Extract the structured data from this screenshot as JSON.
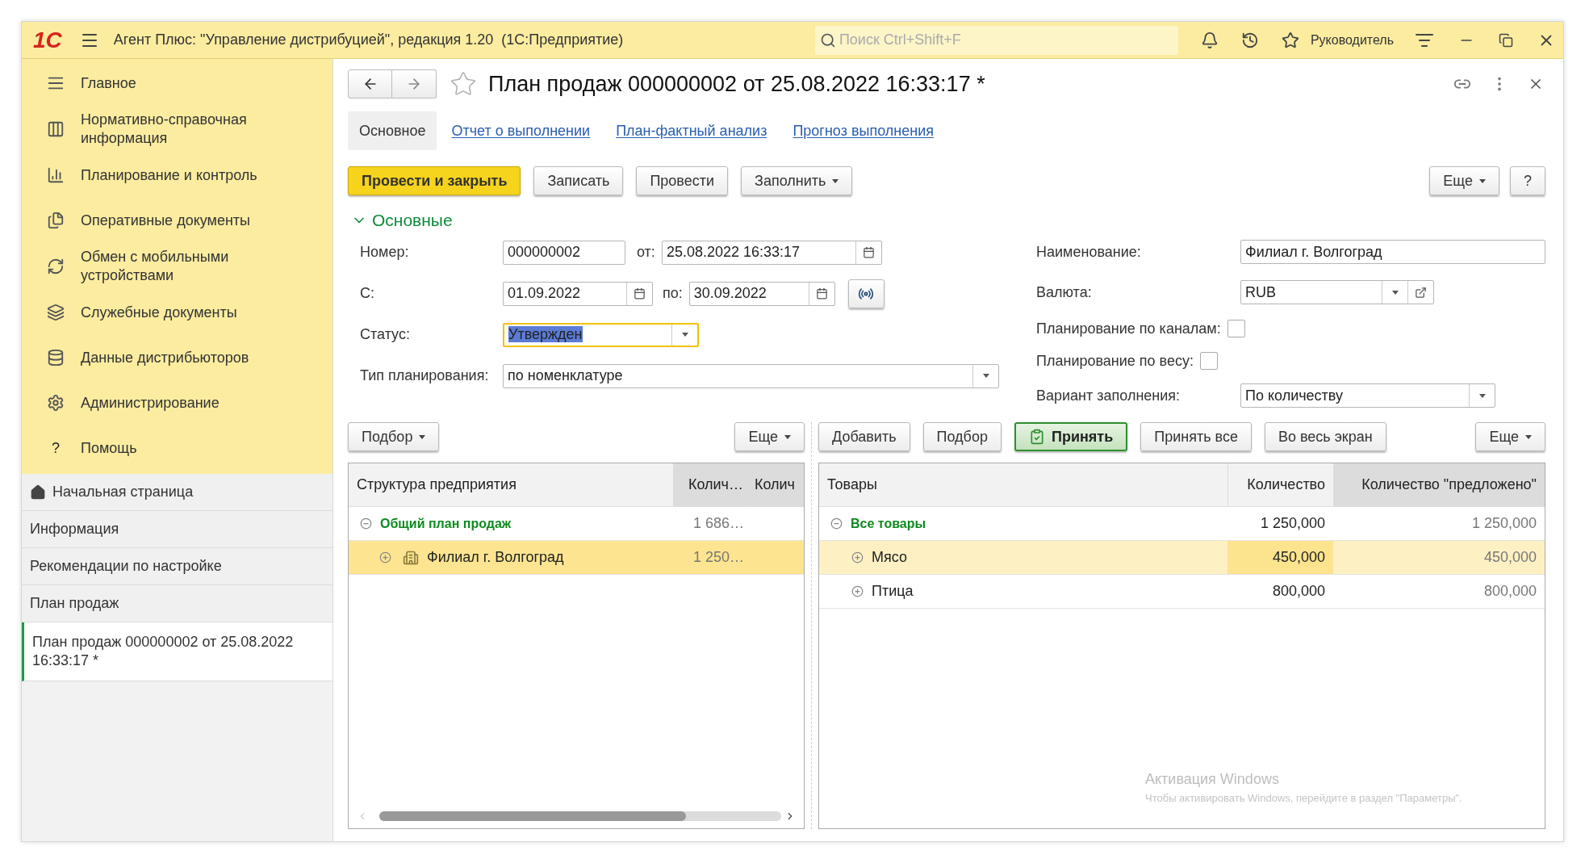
{
  "app_bar": {
    "logo": "1С",
    "title": "Агент Плюс: \"Управление дистрибуцией\", редакция 1.20  (1С:Предприятие)",
    "search": {
      "placeholder": "Поиск Ctrl+Shift+F"
    },
    "user": "Руководитель"
  },
  "sidebar": {
    "sections": [
      {
        "label": "Главное"
      },
      {
        "label": "Нормативно-справочная информация"
      },
      {
        "label": "Планирование и контроль"
      },
      {
        "label": "Оперативные документы"
      },
      {
        "label": "Обмен с мобильными устройствами"
      },
      {
        "label": "Служебные документы"
      },
      {
        "label": "Данные дистрибьюторов"
      },
      {
        "label": "Администрирование"
      },
      {
        "label": "Помощь",
        "kind": "help",
        "glyph": "?"
      }
    ],
    "pages": [
      {
        "label": "Начальная страница",
        "kind": "home",
        "selected": false
      },
      {
        "label": "Информация",
        "selected": false
      },
      {
        "label": "Рекомендации по настройке",
        "selected": false
      },
      {
        "label": "План продаж",
        "selected": false
      },
      {
        "label": "План продаж 000000002 от 25.08.2022 16:33:17 *",
        "selected": true
      }
    ]
  },
  "document": {
    "title": "План продаж 000000002 от 25.08.2022 16:33:17 *",
    "favorite": false,
    "tabs": [
      {
        "label": "Основное",
        "selected": true
      },
      {
        "label": "Отчет о выполнении",
        "selected": false
      },
      {
        "label": "План-фактный анализ",
        "selected": false
      },
      {
        "label": "Прогноз выполнения",
        "selected": false
      }
    ],
    "toolbar": [
      {
        "label": "Провести и закрыть",
        "kind": "primary",
        "dropdown": false
      },
      {
        "label": "Записать",
        "kind": "default",
        "dropdown": false
      },
      {
        "label": "Провести",
        "kind": "default",
        "dropdown": false
      },
      {
        "label": "Заполнить",
        "kind": "default",
        "dropdown": true
      }
    ],
    "toolbar_right": [
      {
        "label": "Еще",
        "kind": "default",
        "dropdown": true
      },
      {
        "label": "?",
        "kind": "default",
        "dropdown": false
      }
    ],
    "group": {
      "title": "Основные",
      "expanded": true
    },
    "number": {
      "label": "Номер:",
      "value": "000000002"
    },
    "date": {
      "label": "от:",
      "value": "25.08.2022 16:33:17"
    },
    "period_start": {
      "label": "С:",
      "value": "01.09.2022"
    },
    "period_end": {
      "label": "по:",
      "value": "30.09.2022"
    },
    "status": {
      "label": "Статус:",
      "value": "Утвержден",
      "focused": true
    },
    "plan_type": {
      "label": "Тип планирования:",
      "value": "по номенклатуре"
    },
    "name": {
      "label": "Наименование:",
      "value": "Филиал г. Волгоград"
    },
    "currency": {
      "label": "Валюта:",
      "value": "RUB"
    },
    "by_channels": {
      "label": "Планирование по каналам:",
      "checked": false
    },
    "by_weight": {
      "label": "Планирование по весу:",
      "checked": false
    },
    "fill_variant": {
      "label": "Вариант заполнения:",
      "value": "По количеству"
    },
    "structure_toolbar": [
      {
        "label": "Подбор",
        "kind": "default",
        "dropdown": true
      },
      {
        "label": "Еще",
        "kind": "default",
        "dropdown": true
      }
    ],
    "goods_toolbar": [
      {
        "label": "Добавить",
        "kind": "default",
        "dropdown": false
      },
      {
        "label": "Подбор",
        "kind": "default",
        "dropdown": false
      },
      {
        "label": "Принять",
        "kind": "accept",
        "dropdown": false
      },
      {
        "label": "Принять все",
        "kind": "default",
        "dropdown": false
      },
      {
        "label": "Во весь экран",
        "kind": "default",
        "dropdown": false
      },
      {
        "label": "Еще",
        "kind": "default",
        "dropdown": true
      }
    ],
    "structure_table": {
      "columns": [
        {
          "label": "Структура предприятия",
          "kind": "text",
          "shaded": false,
          "current": false
        },
        {
          "label": "Колич…",
          "kind": "muted",
          "shaded": true,
          "current": false
        },
        {
          "label": "Колич",
          "kind": "muted",
          "shaded": true,
          "current": false
        }
      ],
      "rows": [
        {
          "cells": [
            "Общий план продаж",
            "1 686…"
          ],
          "expanded": true,
          "selected": false,
          "children": [
            {
              "cells": [
                "Филиал г. Волгоград",
                "1 250…"
              ],
              "expanded": false,
              "selected": true,
              "kind": "branch"
            }
          ]
        }
      ]
    },
    "goods_table": {
      "columns": [
        {
          "label": "Товары",
          "kind": "text",
          "shaded": false,
          "current": false
        },
        {
          "label": "Количество",
          "kind": "number",
          "shaded": false,
          "current": true
        },
        {
          "label": "Количество \"предложено\"",
          "kind": "muted",
          "shaded": true,
          "current": false
        }
      ],
      "rows": [
        {
          "cells": [
            "Все товары",
            "1 250,000",
            "1 250,000"
          ],
          "expanded": true,
          "selected": false,
          "children": [
            {
              "cells": [
                "Мясо",
                "450,000",
                "450,000"
              ],
              "expanded": false,
              "selected": true
            },
            {
              "cells": [
                "Птица",
                "800,000",
                "800,000"
              ],
              "expanded": false,
              "selected": false
            }
          ]
        }
      ]
    }
  },
  "os_notice": {
    "title": "Активация Windows",
    "text": "Чтобы активировать Windows, перейдите в раздел \"Параметры\"."
  }
}
